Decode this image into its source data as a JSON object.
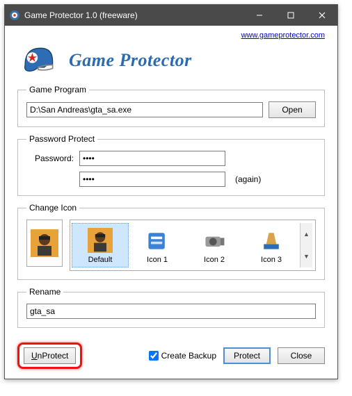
{
  "title": "Game Protector 1.0 (freeware)",
  "link": "www.gameprotector.com",
  "banner": "Game Protector",
  "sections": {
    "program": {
      "legend": "Game Program",
      "path": "D:\\San Andreas\\gta_sa.exe",
      "open": "Open"
    },
    "password": {
      "legend": "Password Protect",
      "label": "Password:",
      "value1": "••••",
      "value2": "••••",
      "again": "(again)"
    },
    "icon": {
      "legend": "Change Icon",
      "items": [
        "Default",
        "Icon 1",
        "Icon 2",
        "Icon 3"
      ]
    },
    "rename": {
      "legend": "Rename",
      "value": "gta_sa"
    }
  },
  "bottom": {
    "unprotect": "UnProtect",
    "backup": "Create Backup",
    "protect": "Protect",
    "close": "Close"
  }
}
